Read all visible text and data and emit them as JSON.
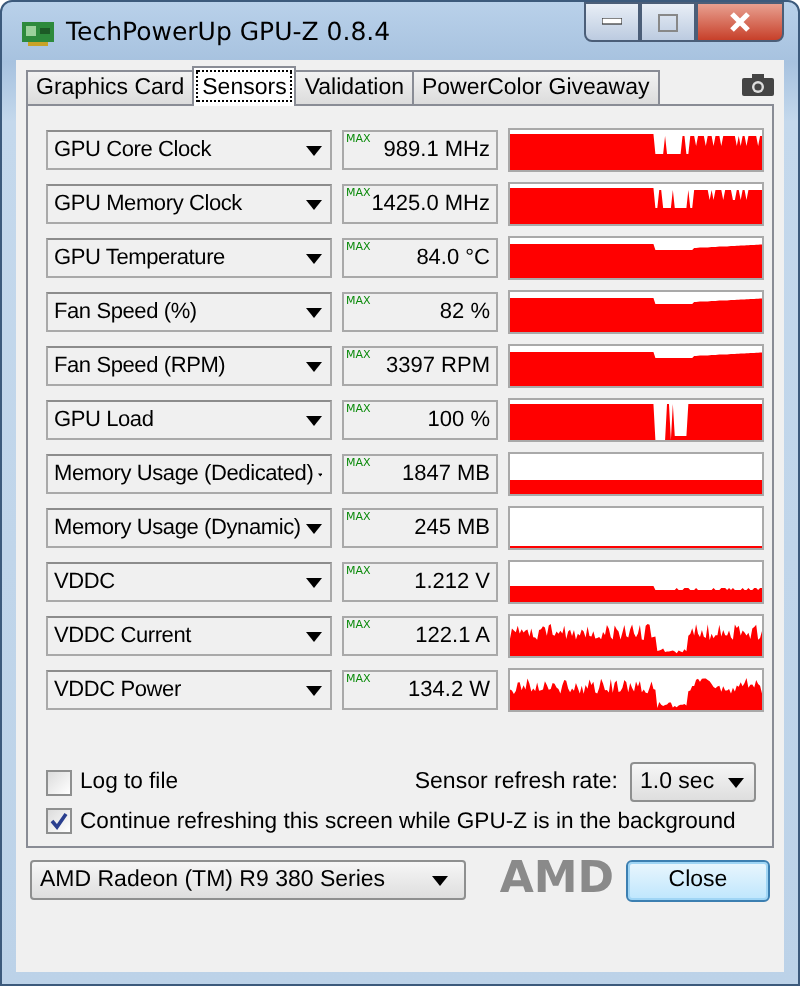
{
  "window": {
    "title": "TechPowerUp GPU-Z 0.8.4"
  },
  "tabs": [
    {
      "label": "Graphics Card",
      "selected": false
    },
    {
      "label": "Sensors",
      "selected": true
    },
    {
      "label": "Validation",
      "selected": false
    },
    {
      "label": "PowerColor Giveaway",
      "selected": false
    }
  ],
  "sensors": [
    {
      "name": "GPU Core Clock",
      "max_label": "MAX",
      "value": "989.1 MHz",
      "kind": "clock"
    },
    {
      "name": "GPU Memory Clock",
      "max_label": "MAX",
      "value": "1425.0 MHz",
      "kind": "clock"
    },
    {
      "name": "GPU Temperature",
      "max_label": "MAX",
      "value": "84.0 °C",
      "kind": "step"
    },
    {
      "name": "Fan Speed (%)",
      "max_label": "MAX",
      "value": "82 %",
      "kind": "step"
    },
    {
      "name": "Fan Speed (RPM)",
      "max_label": "MAX",
      "value": "3397 RPM",
      "kind": "step"
    },
    {
      "name": "GPU Load",
      "max_label": "MAX",
      "value": "100 %",
      "kind": "load"
    },
    {
      "name": "Memory Usage (Dedicated)",
      "max_label": "MAX",
      "value": "1847 MB",
      "kind": "low"
    },
    {
      "name": "Memory Usage (Dynamic)",
      "max_label": "MAX",
      "value": "245 MB",
      "kind": "line"
    },
    {
      "name": "VDDC",
      "max_label": "MAX",
      "value": "1.212 V",
      "kind": "lowstep"
    },
    {
      "name": "VDDC Current",
      "max_label": "MAX",
      "value": "122.1 A",
      "kind": "noisy"
    },
    {
      "name": "VDDC Power",
      "max_label": "MAX",
      "value": "134.2 W",
      "kind": "noisy"
    }
  ],
  "log_to_file": {
    "label": "Log to file",
    "checked": false
  },
  "refresh_rate": {
    "label": "Sensor refresh rate:",
    "value": "1.0 sec"
  },
  "continue_refreshing": {
    "label": "Continue refreshing this screen while GPU-Z is in the background",
    "checked": true
  },
  "gpu_select": {
    "value": "AMD Radeon (TM) R9 380 Series"
  },
  "logo": "AMD",
  "close_button": "Close"
}
